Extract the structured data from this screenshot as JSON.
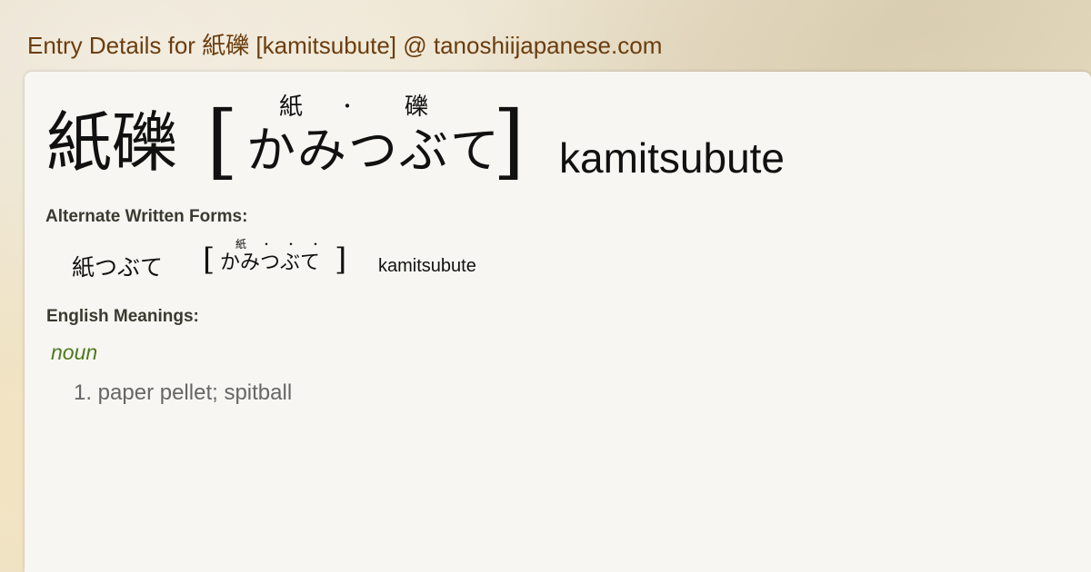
{
  "page": {
    "title": "Entry Details for 紙礫 [kamitsubute] @ tanoshiijapanese.com"
  },
  "entry": {
    "kanji": "紙礫",
    "bracket_open": "[",
    "bracket_close": "]",
    "kana": "かみつぶて",
    "furigana": [
      "紙",
      "・",
      "礫"
    ],
    "romaji": "kamitsubute"
  },
  "alternate": {
    "label": "Alternate Written Forms:",
    "forms": [
      {
        "kanji": "紙つぶて",
        "kana": "かみつぶて",
        "furigana": [
          "紙",
          "・",
          "・",
          "・"
        ],
        "romaji": "kamitsubute"
      }
    ]
  },
  "meanings": {
    "label": "English Meanings:",
    "part_of_speech": "noun",
    "items": [
      "1. paper pellet; spitball"
    ]
  },
  "colors": {
    "title": "#6b3d0e",
    "part_of_speech": "#4e7a1e",
    "card_background": "#f7f6f2"
  }
}
